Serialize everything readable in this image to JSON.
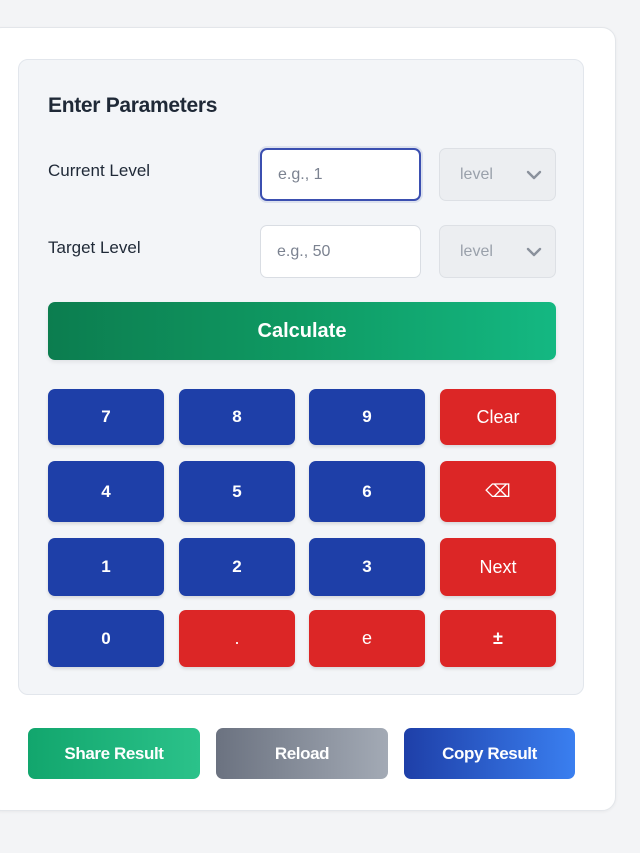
{
  "form": {
    "title": "Enter Parameters",
    "current_level": {
      "label": "Current Level",
      "placeholder": "e.g., 1",
      "value": "",
      "unit": "level"
    },
    "target_level": {
      "label": "Target Level",
      "placeholder": "e.g., 50",
      "value": "",
      "unit": "level"
    },
    "calculate_label": "Calculate"
  },
  "keypad": {
    "rows": [
      [
        "7",
        "8",
        "9",
        "Clear"
      ],
      [
        "4",
        "5",
        "6",
        "⌫"
      ],
      [
        "1",
        "2",
        "3",
        "Next"
      ],
      [
        "0",
        ".",
        "e",
        "±"
      ]
    ]
  },
  "actions": {
    "share_label": "Share Result",
    "reload_label": "Reload",
    "copy_label": "Copy Result"
  },
  "colors": {
    "primary_blue": "#1e3fa8",
    "danger_red": "#dc2626",
    "success_green": "#0f9a63",
    "neutral_gray": "#6b7280"
  },
  "icons": {
    "unit_dropdown": "chevron-down-icon",
    "backspace_key": "backspace-icon"
  }
}
